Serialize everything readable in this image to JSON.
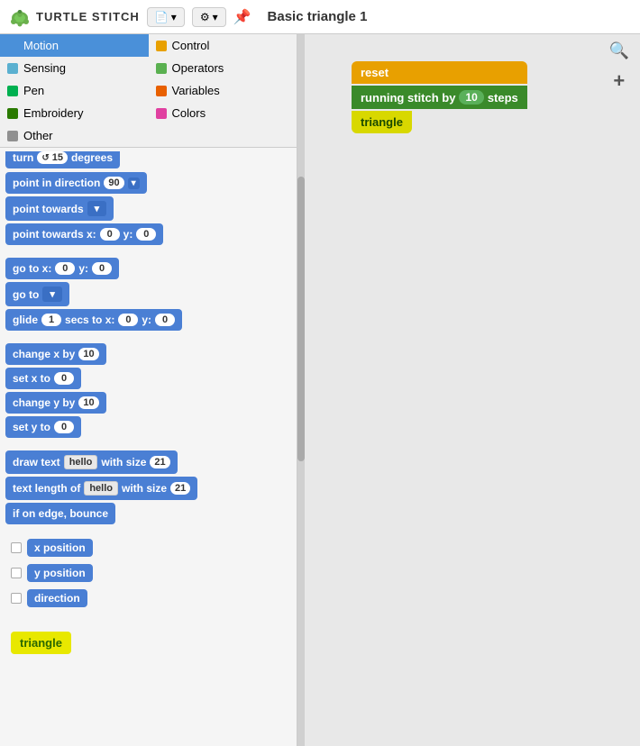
{
  "header": {
    "logo_text": "TURTLE STITCH",
    "file_btn": "▾",
    "settings_btn": "⚙▾",
    "title": "Basic triangle 1"
  },
  "categories": [
    {
      "id": "motion",
      "label": "Motion",
      "color": "#4a90d9",
      "active": true
    },
    {
      "id": "control",
      "label": "Control",
      "color": "#e8a000",
      "active": false
    },
    {
      "id": "sensing",
      "label": "Sensing",
      "color": "#5ab0d0",
      "active": false
    },
    {
      "id": "operators",
      "label": "Operators",
      "color": "#5ab050",
      "active": false
    },
    {
      "id": "pen",
      "label": "Pen",
      "color": "#00b050",
      "active": false
    },
    {
      "id": "variables",
      "label": "Variables",
      "color": "#e86000",
      "active": false
    },
    {
      "id": "embroidery",
      "label": "Embroidery",
      "color": "#2a7a00",
      "active": false
    },
    {
      "id": "colors",
      "label": "Colors",
      "color": "#e040a0",
      "active": false
    },
    {
      "id": "other",
      "label": "Other",
      "color": "#909090",
      "active": false
    }
  ],
  "blocks": [
    {
      "id": "turn_degrees",
      "text": "turn",
      "extra": "15 degrees",
      "type": "turn"
    },
    {
      "id": "point_direction",
      "text": "point in direction",
      "input": "90",
      "dropdown": true
    },
    {
      "id": "point_towards",
      "text": "point towards",
      "dropdown": true
    },
    {
      "id": "point_towards_xy",
      "text": "point towards x:",
      "x": "0",
      "y": "0"
    },
    {
      "id": "go_to_xy",
      "text": "go to x:",
      "x": "0",
      "y": "0"
    },
    {
      "id": "go_to",
      "text": "go to",
      "dropdown": true
    },
    {
      "id": "glide",
      "text": "glide",
      "secs": "1",
      "x": "0",
      "y": "0"
    },
    {
      "id": "change_x",
      "text": "change x by",
      "val": "10"
    },
    {
      "id": "set_x",
      "text": "set x to",
      "val": "0"
    },
    {
      "id": "change_y",
      "text": "change y by",
      "val": "10"
    },
    {
      "id": "set_y",
      "text": "set y to",
      "val": "0"
    },
    {
      "id": "draw_text",
      "text": "draw text",
      "text_val": "hello",
      "size": "21"
    },
    {
      "id": "text_length",
      "text": "text length of",
      "text_val": "hello",
      "size": "21"
    },
    {
      "id": "if_edge",
      "text": "if on edge, bounce"
    }
  ],
  "checkboxes": [
    {
      "id": "x_pos",
      "label": "x position"
    },
    {
      "id": "y_pos",
      "label": "y position"
    },
    {
      "id": "dir",
      "label": "direction"
    }
  ],
  "triangle_label": "triangle",
  "canvas_blocks": [
    {
      "id": "reset",
      "text": "reset",
      "type": "orange"
    },
    {
      "id": "running_stitch",
      "text": "running stitch by",
      "val": "10",
      "suffix": "steps",
      "type": "green"
    },
    {
      "id": "triangle",
      "text": "triangle",
      "type": "yellow"
    }
  ],
  "controls": {
    "search_icon": "🔍",
    "add_icon": "+"
  }
}
